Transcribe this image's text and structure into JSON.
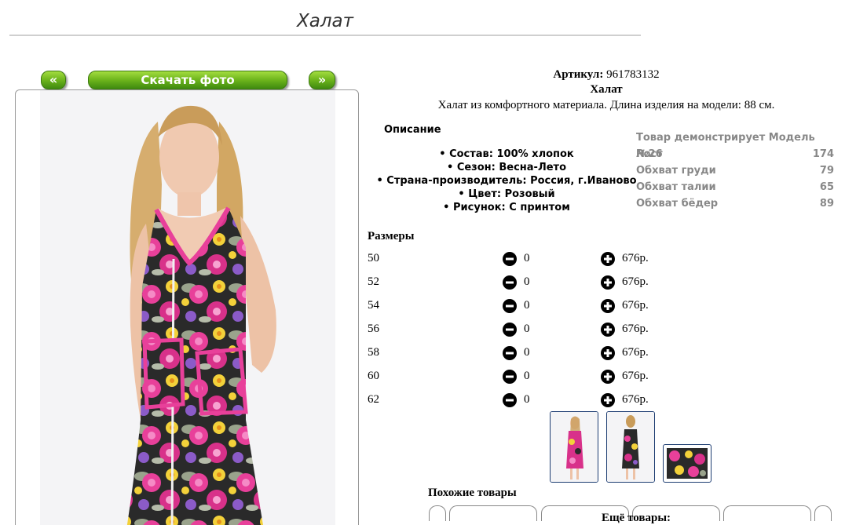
{
  "page": {
    "title": "Халат"
  },
  "nav": {
    "prev_label": "«",
    "download_label": "Скачать фото",
    "next_label": "»"
  },
  "product": {
    "article_label": "Артикул:",
    "article_value": "961783132",
    "name": "Халат",
    "description": "Халат из комфортного материала. Длина изделия на модели: 88 см."
  },
  "details": {
    "title": "Описание",
    "items": [
      "Состав: 100% хлопок",
      "Сезон: Весна-Лето",
      "Страна-производитель: Россия, г.Иваново",
      "Цвет: Розовый",
      "Рисунок: С принтом"
    ]
  },
  "model": {
    "title": "Товар демонстрирует Модель №26",
    "rows": [
      {
        "label": "Рост",
        "value": "174"
      },
      {
        "label": "Обхват груди",
        "value": "79"
      },
      {
        "label": "Обхват талии",
        "value": "65"
      },
      {
        "label": "Обхват бёдер",
        "value": "89"
      }
    ]
  },
  "sizes": {
    "title": "Размеры",
    "rows": [
      {
        "size": "50",
        "qty": "0",
        "price": "676р."
      },
      {
        "size": "52",
        "qty": "0",
        "price": "676р."
      },
      {
        "size": "54",
        "qty": "0",
        "price": "676р."
      },
      {
        "size": "56",
        "qty": "0",
        "price": "676р."
      },
      {
        "size": "58",
        "qty": "0",
        "price": "676р."
      },
      {
        "size": "60",
        "qty": "0",
        "price": "676р."
      },
      {
        "size": "62",
        "qty": "0",
        "price": "676р."
      }
    ]
  },
  "similar": {
    "title": "Похожие товары"
  },
  "more": {
    "title": "Ещё товары:"
  },
  "colors": {
    "accent_green": "#6db41c",
    "dress_pink": "#e8409a",
    "thumb_border": "#1d3d72",
    "model_text": "#888888"
  }
}
